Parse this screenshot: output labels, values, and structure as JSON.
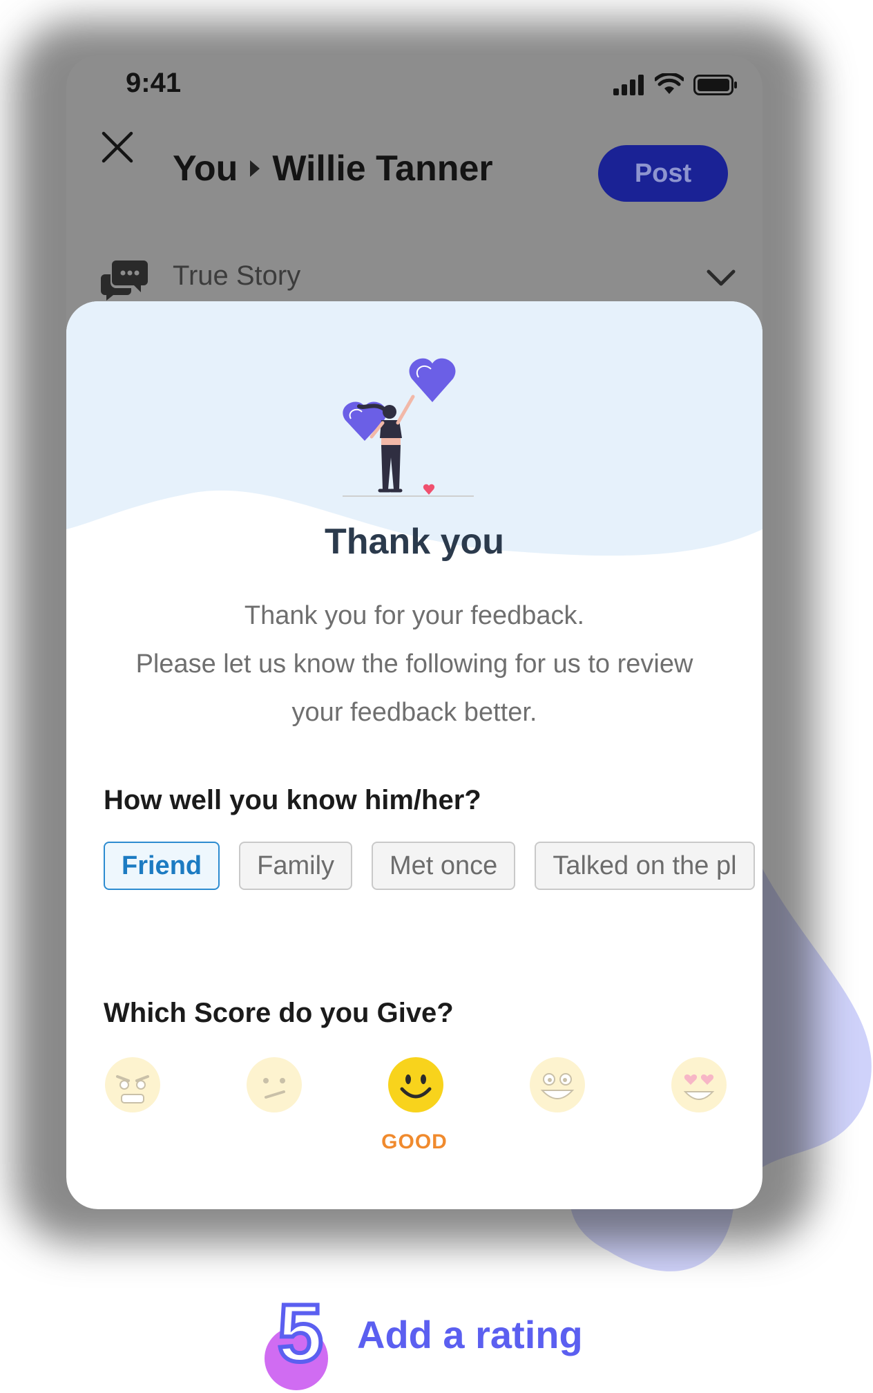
{
  "status_bar": {
    "time": "9:41"
  },
  "header": {
    "from": "You",
    "to": "Willie Tanner",
    "post_label": "Post"
  },
  "category": {
    "label": "True Story"
  },
  "sheet": {
    "title": "Thank you",
    "body_line1": "Thank you for your feedback.",
    "body_line2": "Please let us know the following for us to review",
    "body_line3": "your feedback better.",
    "relation_question": "How well you know him/her?",
    "relation_options": [
      "Friend",
      "Family",
      "Met once",
      "Talked on the pl"
    ],
    "relation_selected": "Friend",
    "score_question": "Which Score do you Give?",
    "score_selected_label": "GOOD"
  },
  "step": {
    "number": "5",
    "label": "Add a rating"
  },
  "colors": {
    "accent": "#5b5ff0",
    "post_button": "#1a2295",
    "chip_selected": "#2c8bd0",
    "rating_label": "#f08a2d"
  },
  "icons": [
    "close-icon",
    "chat-bubbles-icon",
    "chevron-down-icon",
    "signal-icon",
    "wifi-icon",
    "battery-icon"
  ]
}
